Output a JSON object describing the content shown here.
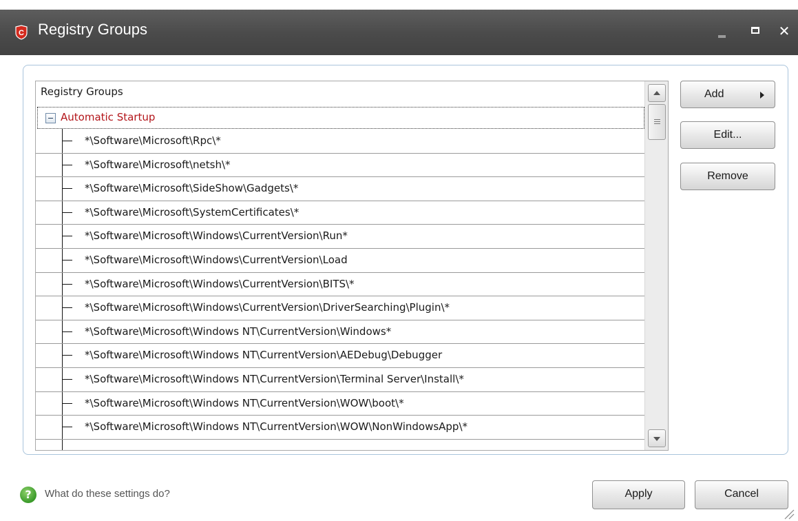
{
  "window": {
    "title": "Registry Groups",
    "minimize_label": "minimize",
    "maximize_label": "maximize",
    "close_glyph": "✕"
  },
  "list": {
    "header": "Registry Groups",
    "group": {
      "label": "Automatic Startup",
      "expanded": true,
      "items": [
        "*\\Software\\Microsoft\\Rpc\\*",
        "*\\Software\\Microsoft\\netsh\\*",
        "*\\Software\\Microsoft\\SideShow\\Gadgets\\*",
        "*\\Software\\Microsoft\\SystemCertificates\\*",
        "*\\Software\\Microsoft\\Windows\\CurrentVersion\\Run*",
        "*\\Software\\Microsoft\\Windows\\CurrentVersion\\Load",
        "*\\Software\\Microsoft\\Windows\\CurrentVersion\\BITS\\*",
        "*\\Software\\Microsoft\\Windows\\CurrentVersion\\DriverSearching\\Plugin\\*",
        "*\\Software\\Microsoft\\Windows NT\\CurrentVersion\\Windows*",
        "*\\Software\\Microsoft\\Windows NT\\CurrentVersion\\AEDebug\\Debugger",
        "*\\Software\\Microsoft\\Windows NT\\CurrentVersion\\Terminal Server\\Install\\*",
        "*\\Software\\Microsoft\\Windows NT\\CurrentVersion\\WOW\\boot\\*",
        "*\\Software\\Microsoft\\Windows NT\\CurrentVersion\\WOW\\NonWindowsApp\\*"
      ]
    }
  },
  "buttons": {
    "add": "Add",
    "edit": "Edit...",
    "remove": "Remove",
    "apply": "Apply",
    "cancel": "Cancel"
  },
  "footer": {
    "help_text": "What do these settings do?",
    "help_icon": "help-icon"
  },
  "colors": {
    "titlebar": "#4a4a4a",
    "group_label": "#b3151a",
    "brand_icon": "#d42a1e",
    "panel_border": "#a9c4dc"
  }
}
